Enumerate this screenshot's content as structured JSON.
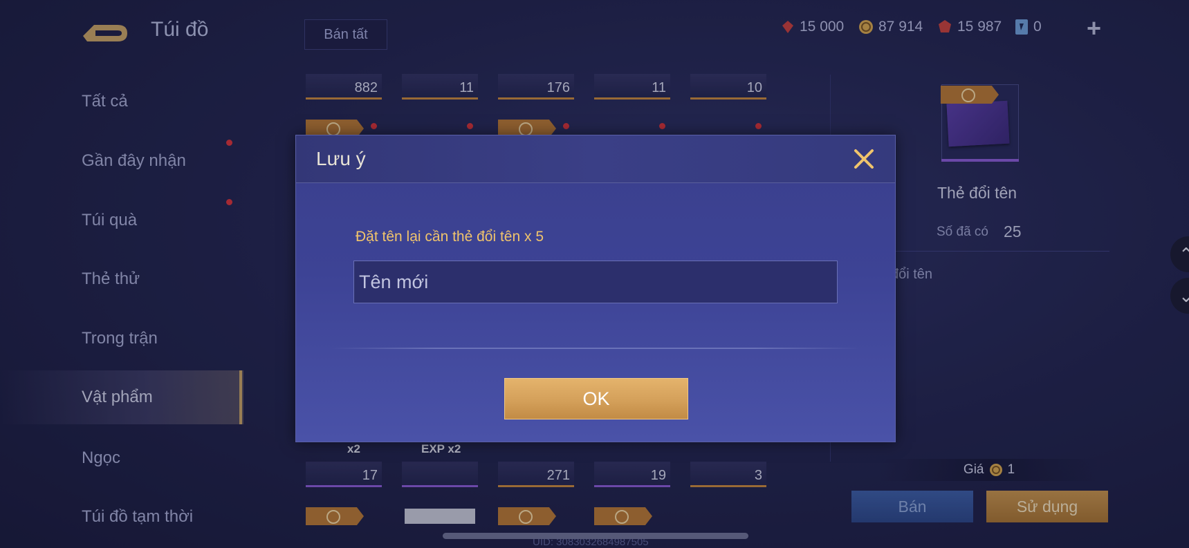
{
  "header": {
    "title": "Túi đồ",
    "sell_all_label": "Bán tất",
    "currencies": [
      {
        "icon": "ruby-icon",
        "value": "15 000"
      },
      {
        "icon": "gold-coin-icon",
        "value": "87 914"
      },
      {
        "icon": "red-gem-icon",
        "value": "15 987"
      },
      {
        "icon": "blue-card-icon",
        "value": "0"
      }
    ],
    "add_icon": "plus-icon"
  },
  "sidebar": {
    "items": [
      {
        "label": "Tất cả",
        "dot": false
      },
      {
        "label": "Gần đây nhận",
        "dot": true
      },
      {
        "label": "Túi quà",
        "dot": true
      },
      {
        "label": "Thẻ thử",
        "dot": false
      },
      {
        "label": "Trong trận",
        "dot": false
      },
      {
        "label": "Vật phẩm",
        "dot": false,
        "active": true
      },
      {
        "label": "Ngọc",
        "dot": false
      },
      {
        "label": "Túi đồ tạm thời",
        "dot": false
      }
    ]
  },
  "grid": {
    "row_top_counts": [
      "882",
      "11",
      "176",
      "11",
      "10"
    ],
    "row_bottom_counts": [
      "17",
      "",
      "271",
      "19",
      "3"
    ],
    "overlay_labels": [
      "x2",
      "EXP x2"
    ]
  },
  "detail": {
    "item_name": "Thẻ đổi tên",
    "owned_label": "Số đã có",
    "owned_value": "25",
    "description_fragment": "đổi tên",
    "price_label": "Giá",
    "price_value": "1",
    "sell_label": "Bán",
    "use_label": "Sử dụng"
  },
  "footer": {
    "uid": "UID: 3083032684987505"
  },
  "dialog": {
    "title": "Lưu ý",
    "prompt": "Đặt tên lại cần thẻ đổi tên x 5",
    "input_placeholder": "Tên mới",
    "input_value": "",
    "ok_label": "OK"
  },
  "colors": {
    "accent_gold": "#e4b36c",
    "prompt_text": "#f0c46c",
    "dialog_bg": "#3d4395",
    "notification_dot": "#d8343a"
  }
}
